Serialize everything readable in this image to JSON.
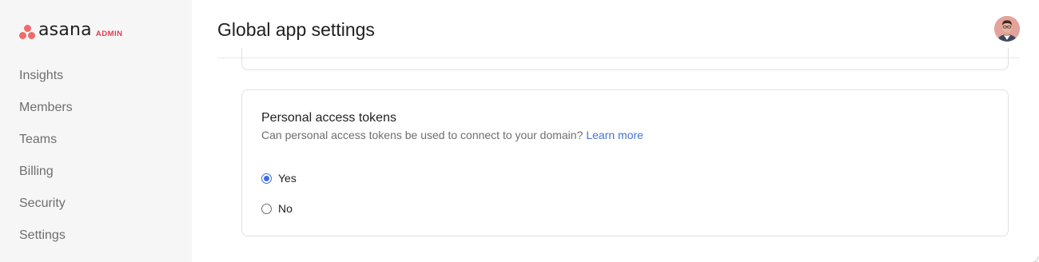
{
  "sidebar": {
    "logo_text": "asana",
    "logo_tag": "ADMIN",
    "items": [
      {
        "label": "Insights"
      },
      {
        "label": "Members"
      },
      {
        "label": "Teams"
      },
      {
        "label": "Billing"
      },
      {
        "label": "Security"
      },
      {
        "label": "Settings"
      }
    ]
  },
  "header": {
    "title": "Global app settings",
    "avatar_icon": "user-avatar"
  },
  "card": {
    "title": "Personal access tokens",
    "description": "Can personal access tokens be used to connect to your domain?",
    "learn_more": "Learn more",
    "options": [
      {
        "label": "Yes",
        "checked": true
      },
      {
        "label": "No",
        "checked": false
      }
    ]
  },
  "colors": {
    "brand": "#f06a6a",
    "link": "#4573d2",
    "radio_selected": "#3b6ee3",
    "sidebar_bg": "#f6f6f6"
  }
}
